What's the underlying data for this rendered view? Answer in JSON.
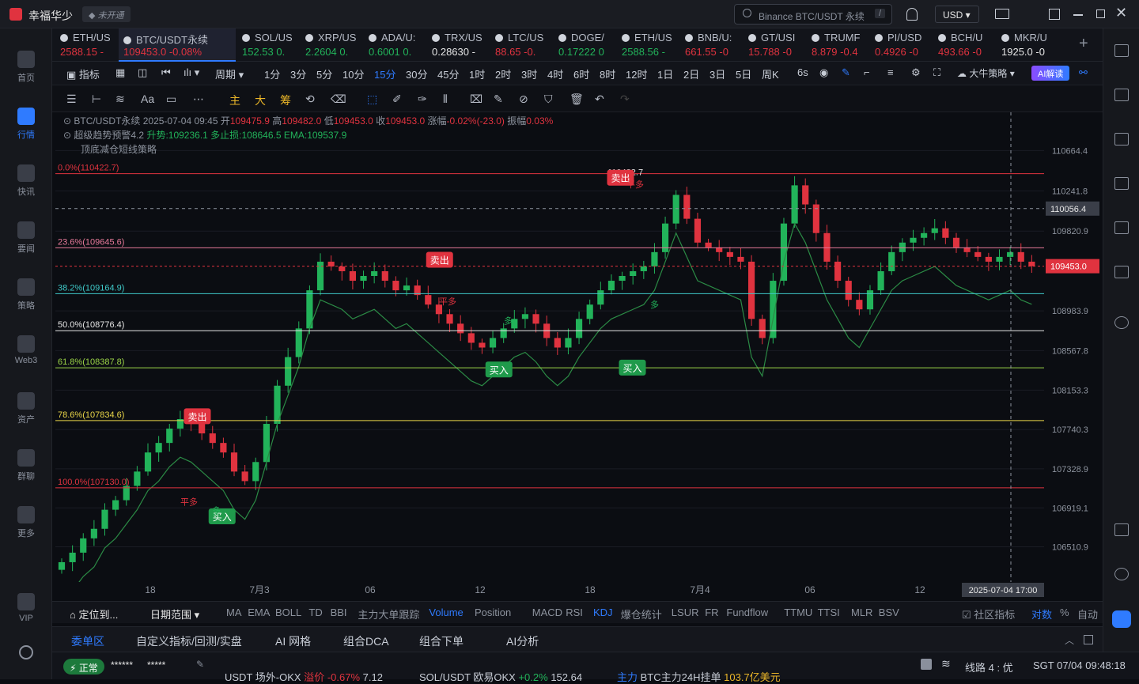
{
  "app": {
    "title": "幸福华少",
    "badge": "未开通",
    "search_placeholder": "Binance BTC/USDT 永续",
    "search_shortcut": "/",
    "currency": "USD"
  },
  "sidebar": [
    {
      "label": "首页",
      "icon": "home-icon"
    },
    {
      "label": "行情",
      "icon": "market-icon",
      "active": true
    },
    {
      "label": "快讯",
      "icon": "news-icon"
    },
    {
      "label": "要闻",
      "icon": "headline-icon"
    },
    {
      "label": "策略",
      "icon": "strategy-icon"
    },
    {
      "label": "Web3",
      "icon": "web3-icon"
    },
    {
      "label": "资产",
      "icon": "wallet-icon"
    },
    {
      "label": "群聊",
      "icon": "chat-icon"
    },
    {
      "label": "更多",
      "icon": "more-icon"
    },
    {
      "label": "VIP",
      "icon": "vip-icon"
    }
  ],
  "tabs": [
    {
      "name": "ETH/US",
      "price": "2588.15 -",
      "color": "dn"
    },
    {
      "name": "BTC/USDT永续",
      "price": "109453.0  -0.08%",
      "color": "dn",
      "active": true
    },
    {
      "name": "SOL/US",
      "price": "152.53  0.",
      "color": "up"
    },
    {
      "name": "XRP/US",
      "price": "2.2604  0.",
      "color": "up"
    },
    {
      "name": "ADA/U:",
      "price": "0.6001  0.",
      "color": "up"
    },
    {
      "name": "TRX/US",
      "price": "0.28630 -",
      "color": "wh"
    },
    {
      "name": "LTC/US",
      "price": "88.65  -0.",
      "color": "dn"
    },
    {
      "name": "DOGE/",
      "price": "0.17222  0",
      "color": "up"
    },
    {
      "name": "ETH/US",
      "price": "2588.56 -",
      "color": "up"
    },
    {
      "name": "BNB/U:",
      "price": "661.55  -0",
      "color": "dn"
    },
    {
      "name": "GT/USI",
      "price": "15.788  -0",
      "color": "dn"
    },
    {
      "name": "TRUMF",
      "price": "8.879  -0.4",
      "color": "dn"
    },
    {
      "name": "PI/USD",
      "price": "0.4926  -0",
      "color": "dn"
    },
    {
      "name": "BCH/U",
      "price": "493.66  -0",
      "color": "dn"
    },
    {
      "name": "MKR/U",
      "price": "1925.0  -0",
      "color": "wh"
    }
  ],
  "toolbar1": {
    "indicator": "指标",
    "period": "周期",
    "intervals": [
      "1分",
      "3分",
      "5分",
      "10分",
      "15分",
      "30分",
      "45分",
      "1时",
      "2时",
      "3时",
      "4时",
      "6时",
      "8时",
      "12时",
      "1日",
      "2日",
      "3日",
      "5日",
      "周K"
    ],
    "selected": "15分",
    "refresh": "6s",
    "strategy": "大牛策略",
    "ai": "AI解读"
  },
  "toolbar2": {
    "main": "主",
    "big": "大",
    "chip": "筹"
  },
  "legend": {
    "line1_symbol": "BTC/USDT永续 2025-07-04 09:45",
    "open_label": "开",
    "open": "109475.9",
    "high_label": "高",
    "high": "109482.0",
    "low_label": "低",
    "low": "109453.0",
    "close_label": "收",
    "close": "109453.0",
    "chg_label": "涨幅",
    "chg": "-0.02%(-23.0)",
    "amp_label": "振幅",
    "amp": "0.03%",
    "line2_name": "超级趋势预警4.2",
    "line2_vals": "升势:109236.1  多止损:108646.5  EMA:109537.9",
    "line3_name": "顶底减仓短线策略"
  },
  "chart_data": {
    "type": "candlestick",
    "symbol": "BTC/USDT永续",
    "interval": "15分",
    "ylim": [
      106300,
      110900
    ],
    "y_ticks": [
      "110664.4",
      "110241.8",
      "109820.9",
      "108983.9",
      "108567.8",
      "108153.3",
      "107740.3",
      "107328.9",
      "106919.1",
      "106510.9"
    ],
    "crosshair_price": "110056.4",
    "last_price": "109453.0",
    "peak_label": "110422.7",
    "x_ticks": [
      "18",
      "7月3",
      "06",
      "12",
      "18",
      "7月4",
      "06",
      "12"
    ],
    "cursor_time": "2025-07-04 17:00",
    "fib_levels": [
      {
        "label": "0.0%(110422.7)",
        "value": 110422.7,
        "color": "#e0333f"
      },
      {
        "label": "23.6%(109645.6)",
        "value": 109645.6,
        "color": "#e87a9a"
      },
      {
        "label": "38.2%(109164.9)",
        "value": 109164.9,
        "color": "#3fc9c9"
      },
      {
        "label": "50.0%(108776.4)",
        "value": 108776.4,
        "color": "#e6e6e6"
      },
      {
        "label": "61.8%(108387.8)",
        "value": 108387.8,
        "color": "#9bd447"
      },
      {
        "label": "78.6%(107834.6)",
        "value": 107834.6,
        "color": "#e9d548"
      },
      {
        "label": "100.0%(107130.0)",
        "value": 107130.0,
        "color": "#e0333f"
      }
    ],
    "signals": [
      {
        "text": "卖出",
        "type": "sell",
        "x": 0.13,
        "price": 107880
      },
      {
        "text": "买入",
        "type": "buy",
        "x": 0.155,
        "price": 106830
      },
      {
        "text": "卖出",
        "type": "sell",
        "x": 0.375,
        "price": 109520
      },
      {
        "text": "买入",
        "type": "buy",
        "x": 0.435,
        "price": 108370
      },
      {
        "text": "卖出",
        "type": "sell",
        "x": 0.558,
        "price": 110380
      },
      {
        "text": "买入",
        "type": "buy",
        "x": 0.57,
        "price": 108390
      }
    ],
    "markers": [
      "平多",
      "平多",
      "平多",
      "多",
      "多",
      "多"
    ],
    "series_close": [
      106350,
      106450,
      106600,
      106700,
      106900,
      107000,
      107150,
      107300,
      107500,
      107600,
      107750,
      107850,
      107800,
      107700,
      107600,
      107500,
      107300,
      107200,
      107400,
      107800,
      108200,
      108500,
      108800,
      109200,
      109500,
      109450,
      109400,
      109300,
      109350,
      109400,
      109300,
      109200,
      109250,
      109150,
      109050,
      108950,
      108850,
      108750,
      108650,
      108600,
      108700,
      108800,
      108900,
      108950,
      108850,
      108700,
      108600,
      108700,
      108900,
      109050,
      109200,
      109300,
      109350,
      109400,
      109450,
      109600,
      109900,
      110200,
      109950,
      109700,
      109650,
      109600,
      109550,
      109500,
      108900,
      108700,
      109300,
      109900,
      110300,
      110100,
      109800,
      109500,
      109300,
      109100,
      109000,
      109200,
      109400,
      109600,
      109700,
      109750,
      109800,
      109850,
      109750,
      109650,
      109600,
      109550,
      109500,
      109550,
      109600,
      109500,
      109453
    ]
  },
  "indicator_bar": {
    "locate": "定位到...",
    "date_range": "日期范围",
    "items": [
      "MA",
      "EMA",
      "BOLL",
      "TD",
      "BBI",
      "主力大单跟踪",
      "Volume",
      "Position",
      "MACD",
      "RSI",
      "KDJ",
      "爆仓统计",
      "LSUR",
      "FR",
      "Fundflow",
      "TTMU",
      "TTSI",
      "MLR",
      "BSV"
    ],
    "selected": [
      "Volume",
      "KDJ"
    ],
    "community": "社区指标",
    "log": "对数",
    "pct": "%",
    "auto": "自动"
  },
  "bottom_tabs": [
    "委单区",
    "自定义指标/回测/实盘",
    "AI 网格",
    "组合DCA",
    "组合下单",
    "AI分析"
  ],
  "status": {
    "state": "正常",
    "masked1": "******",
    "masked2": "*****",
    "t1_name": "USDT 场外-OKX",
    "t1_label": "溢价",
    "t1_val": "-0.67%",
    "t1_num": "7.12",
    "t2_name": "SOL/USDT 欧易OKX",
    "t2_val": "+0.2%",
    "t2_num": "152.64",
    "t3_tag": "主力",
    "t3_text": "BTC主力24H挂单",
    "t3_val": "103.7亿美元",
    "line": "线路 4 : 优",
    "time": "SGT  07/04 09:48:18"
  }
}
